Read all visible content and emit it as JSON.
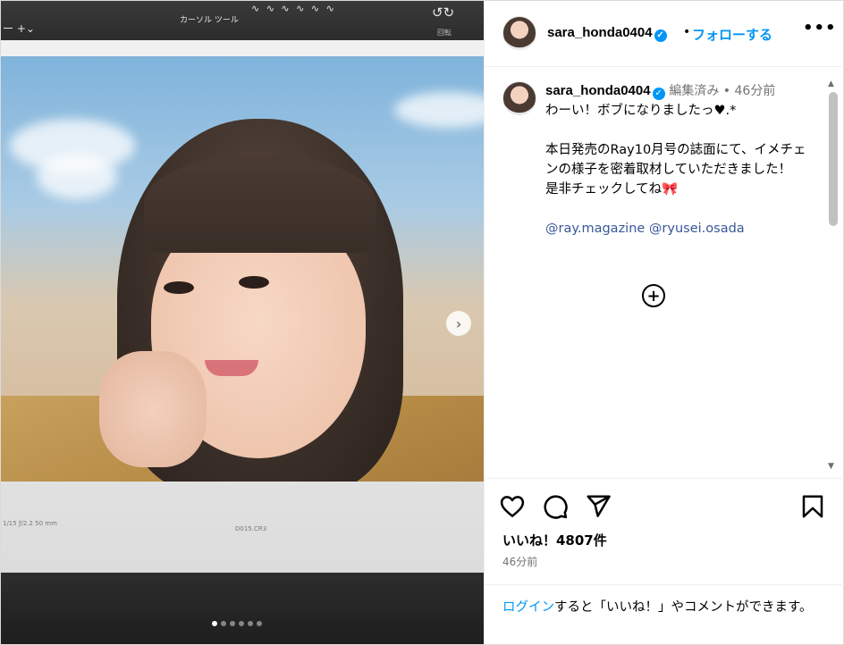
{
  "photo": {
    "toolbar_label": "カーソル ツール",
    "toolbar_left": "ー +⌄",
    "toolbar_squiggles": "∿ ∿ ∿ ∿ ∿ ∿",
    "rotate_icons": "↺↻",
    "rotate_label": "回転",
    "meta_left": "1/15   ƒ/2.2   50 mm",
    "meta_center": "D015.CR3",
    "carousel_total": 6,
    "carousel_active_index": 0
  },
  "header": {
    "username": "sara_honda0404",
    "separator": "•",
    "follow_label": "フォローする",
    "more_label": "•••"
  },
  "caption": {
    "username": "sara_honda0404",
    "meta": "編集済み • 46分前",
    "lines": [
      "わーい！ボブになりましたっ♥.*",
      "",
      "本日発売のRay10月号の誌面にて、イメチェンの様子を密着取材していただきました！",
      "是非チェックしてね🎀",
      "",
      "@ray.magazine @ryusei.osada"
    ],
    "expand_label": "+"
  },
  "actions": {
    "likes": "いいね！4807件",
    "time": "46分前"
  },
  "login": {
    "link": "ログイン",
    "rest": "すると「いいね！」やコメントができます。"
  },
  "colors": {
    "accent": "#0095f6",
    "mention": "#00376b",
    "muted": "#737373"
  }
}
